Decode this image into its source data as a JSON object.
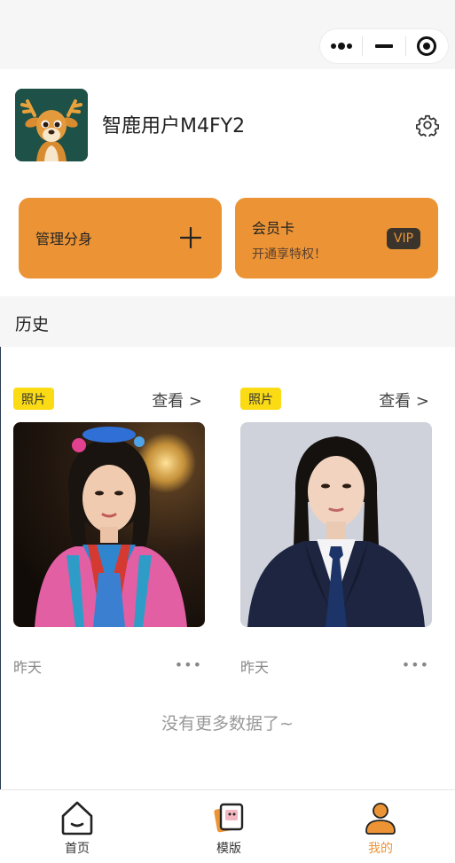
{
  "profile": {
    "username": "智鹿用户M4FY2"
  },
  "cards": {
    "manage": {
      "title": "管理分身"
    },
    "member": {
      "title": "会员卡",
      "subtitle": "开通享特权！",
      "badge": "VIP"
    }
  },
  "history": {
    "heading": "历史",
    "items": [
      {
        "tag": "照片",
        "view": "查看 >",
        "date": "昨天",
        "more": "•••"
      },
      {
        "tag": "照片",
        "view": "查看 >",
        "date": "昨天",
        "more": "•••"
      }
    ],
    "no_more": "没有更多数据了~"
  },
  "tabbar": {
    "items": [
      {
        "label": "首页",
        "icon": "home-icon"
      },
      {
        "label": "模版",
        "icon": "template-icon"
      },
      {
        "label": "我的",
        "icon": "profile-icon",
        "active": true
      }
    ]
  },
  "colors": {
    "accent": "#ec9435",
    "tag": "#fadb14",
    "section_bg": "#f6f6f6"
  }
}
